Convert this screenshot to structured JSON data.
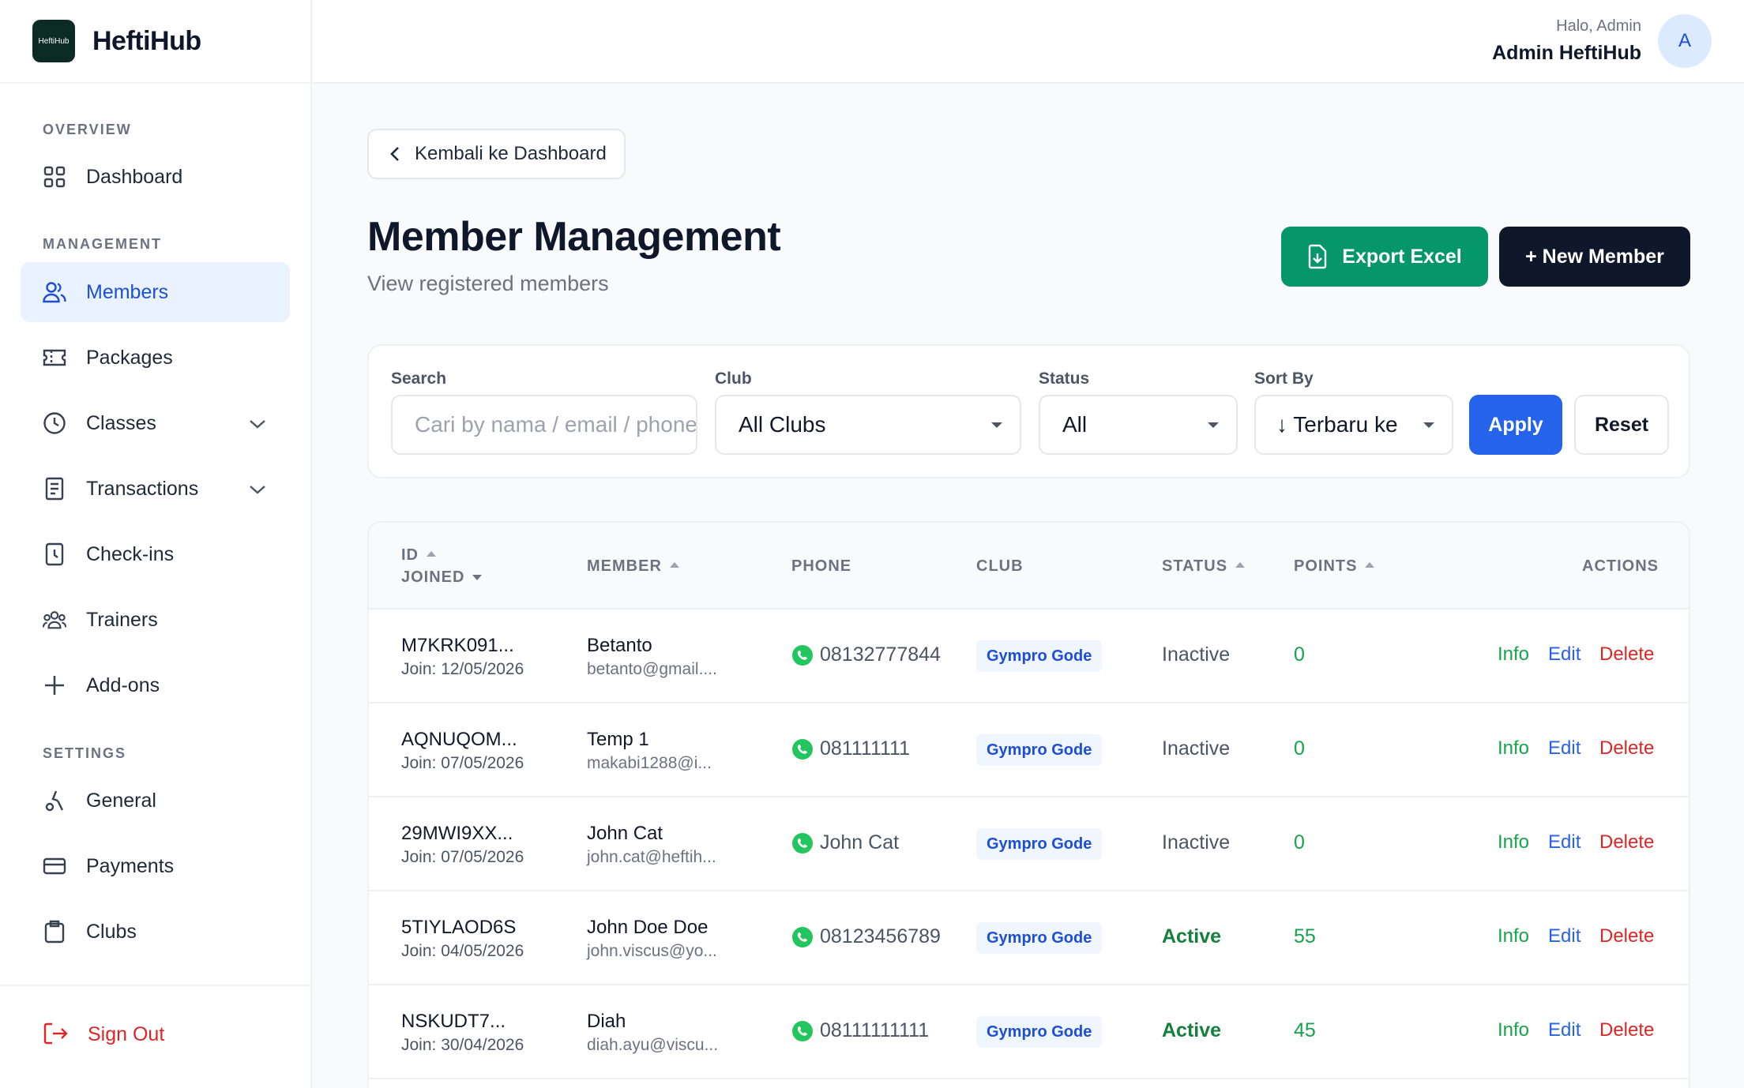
{
  "brand": {
    "logo_text": "HeftiHub",
    "name": "HeftiHub"
  },
  "topbar": {
    "greeting": "Halo, Admin",
    "user_name": "Admin HeftiHub",
    "avatar_initial": "A"
  },
  "sidebar": {
    "sections": {
      "overview": "OVERVIEW",
      "management": "MANAGEMENT",
      "settings": "SETTINGS"
    },
    "items": {
      "dashboard": "Dashboard",
      "members": "Members",
      "packages": "Packages",
      "classes": "Classes",
      "transactions": "Transactions",
      "checkins": "Check-ins",
      "trainers": "Trainers",
      "addons": "Add-ons",
      "general": "General",
      "payments": "Payments",
      "clubs": "Clubs"
    },
    "active_item": "members",
    "sign_out": "Sign Out"
  },
  "main": {
    "back_label": "Kembali ke Dashboard",
    "title": "Member Management",
    "subtitle": "View registered members",
    "export_label": "Export Excel",
    "new_member_label": "+ New Member"
  },
  "filters": {
    "search_label": "Search",
    "search_placeholder": "Cari by nama / email / phone",
    "club_label": "Club",
    "club_value": "All Clubs",
    "status_label": "Status",
    "status_value": "All",
    "sort_label": "Sort By",
    "sort_value": "↓ Terbaru ke",
    "apply_label": "Apply",
    "reset_label": "Reset"
  },
  "table": {
    "headers": {
      "id": "ID",
      "joined": "JOINED",
      "member": "MEMBER",
      "phone": "PHONE",
      "club": "CLUB",
      "status": "STATUS",
      "points": "POINTS",
      "actions": "ACTIONS"
    },
    "action_labels": {
      "info": "Info",
      "edit": "Edit",
      "delete": "Delete"
    },
    "rows": [
      {
        "id": "M7KRK091...",
        "join": "Join: 12/05/2026",
        "name": "Betanto",
        "email": "betanto@gmail....",
        "phone": "08132777844",
        "club": "Gympro Gode",
        "status": "Inactive",
        "points": "0"
      },
      {
        "id": "AQNUQOM...",
        "join": "Join: 07/05/2026",
        "name": "Temp 1",
        "email": "makabi1288@i...",
        "phone": "081111111",
        "club": "Gympro Gode",
        "status": "Inactive",
        "points": "0"
      },
      {
        "id": "29MWI9XX...",
        "join": "Join: 07/05/2026",
        "name": "John Cat",
        "email": "john.cat@heftih...",
        "phone": "John Cat",
        "club": "Gympro Gode",
        "status": "Inactive",
        "points": "0"
      },
      {
        "id": "5TIYLAOD6S",
        "join": "Join: 04/05/2026",
        "name": "John Doe Doe",
        "email": "john.viscus@yo...",
        "phone": "08123456789",
        "club": "Gympro Gode",
        "status": "Active",
        "points": "55"
      },
      {
        "id": "NSKUDT7...",
        "join": "Join: 30/04/2026",
        "name": "Diah",
        "email": "diah.ayu@viscu...",
        "phone": "08111111111",
        "club": "Gympro Gode",
        "status": "Active",
        "points": "45"
      }
    ]
  },
  "colors": {
    "accent": "#2563eb",
    "export": "#059669",
    "primary_dark": "#0f172a",
    "active_nav_bg": "#eaf2ff",
    "danger": "#dc2626",
    "success": "#16a34a"
  }
}
